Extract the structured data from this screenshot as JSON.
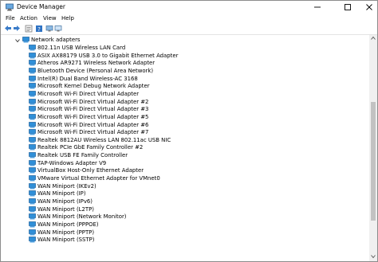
{
  "window": {
    "title": "Device Manager",
    "minimize_icon": "minimize-icon",
    "maximize_icon": "maximize-icon",
    "close_icon": "close-icon"
  },
  "menu": {
    "items": [
      {
        "label": "File"
      },
      {
        "label": "Action"
      },
      {
        "label": "View"
      },
      {
        "label": "Help"
      }
    ]
  },
  "toolbar": {
    "buttons": [
      "back-arrow-icon",
      "forward-arrow-icon",
      "properties-icon",
      "help-icon",
      "scan-hardware-icon",
      "monitor-icon"
    ]
  },
  "tree": {
    "category": {
      "label": "Network adapters",
      "expanded": true,
      "icon": "network-adapter-icon"
    },
    "devices": [
      {
        "label": "802.11n USB Wireless LAN Card"
      },
      {
        "label": "ASIX AX88179 USB 3.0 to Gigabit Ethernet Adapter"
      },
      {
        "label": "Atheros AR9271 Wireless Network Adapter"
      },
      {
        "label": "Bluetooth Device (Personal Area Network)"
      },
      {
        "label": "Intel(R) Dual Band Wireless-AC 3168"
      },
      {
        "label": "Microsoft Kernel Debug Network Adapter"
      },
      {
        "label": "Microsoft Wi-Fi Direct Virtual Adapter"
      },
      {
        "label": "Microsoft Wi-Fi Direct Virtual Adapter #2"
      },
      {
        "label": "Microsoft Wi-Fi Direct Virtual Adapter #3"
      },
      {
        "label": "Microsoft Wi-Fi Direct Virtual Adapter #5"
      },
      {
        "label": "Microsoft Wi-Fi Direct Virtual Adapter #6"
      },
      {
        "label": "Microsoft Wi-Fi Direct Virtual Adapter #7"
      },
      {
        "label": "Realtek 8812AU Wireless LAN 802.11ac USB NIC"
      },
      {
        "label": "Realtek PCIe GbE Family Controller #2"
      },
      {
        "label": "Realtek USB FE Family Controller"
      },
      {
        "label": "TAP-Windows Adapter V9"
      },
      {
        "label": "VirtualBox Host-Only Ethernet Adapter"
      },
      {
        "label": "VMware Virtual Ethernet Adapter for VMnet0"
      },
      {
        "label": "WAN Miniport (IKEv2)"
      },
      {
        "label": "WAN Miniport (IP)"
      },
      {
        "label": "WAN Miniport (IPv6)"
      },
      {
        "label": "WAN Miniport (L2TP)"
      },
      {
        "label": "WAN Miniport (Network Monitor)"
      },
      {
        "label": "WAN Miniport (PPPOE)"
      },
      {
        "label": "WAN Miniport (PPTP)"
      },
      {
        "label": "WAN Miniport (SSTP)"
      }
    ]
  },
  "colors": {
    "adapter_blue": "#2f8fd8",
    "adapter_dark": "#1c5f9c",
    "scrollbar_thumb": "#c2c2c2"
  }
}
